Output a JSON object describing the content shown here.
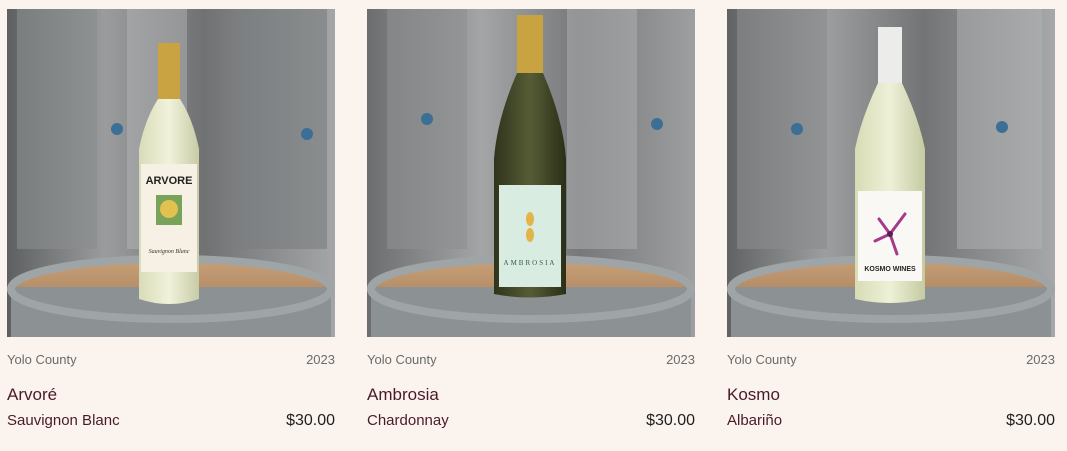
{
  "products": [
    {
      "region": "Yolo County",
      "vintage": "2023",
      "name": "Arvoré",
      "varietal": "Sauvignon Blanc",
      "price": "$30.00",
      "label_brand": "ARVORE",
      "foil_color": "#c9a241",
      "label_color": "#f6f1e4"
    },
    {
      "region": "Yolo County",
      "vintage": "2023",
      "name": "Ambrosia",
      "varietal": "Chardonnay",
      "price": "$30.00",
      "label_brand": "AMBROSIA",
      "foil_color": "#c9a241",
      "label_color": "#d9ece2"
    },
    {
      "region": "Yolo County",
      "vintage": "2023",
      "name": "Kosmo",
      "varietal": "Albariño",
      "price": "$30.00",
      "label_brand": "KOSMO WINES",
      "foil_color": "#ececea",
      "label_color": "#faf8f5"
    }
  ]
}
